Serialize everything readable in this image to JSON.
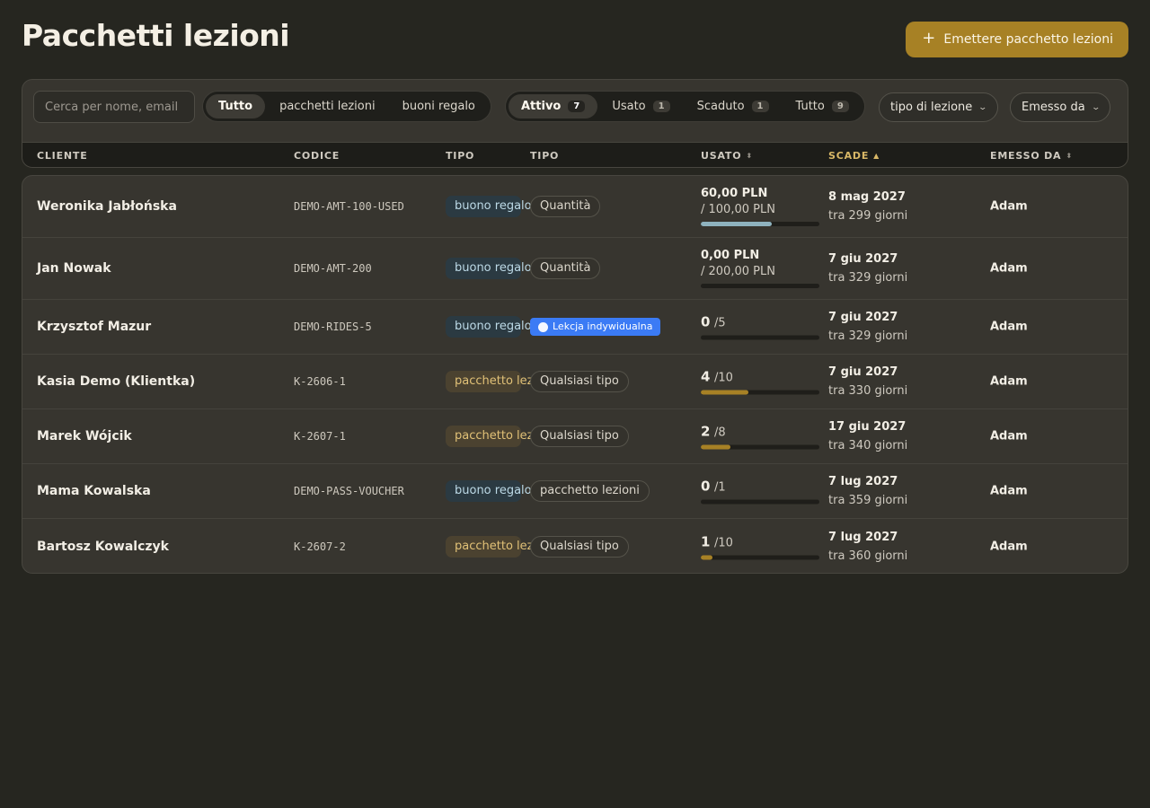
{
  "page": {
    "title": "Pacchetti lezioni",
    "issue_button": "Emettere pacchetto lezioni"
  },
  "search": {
    "placeholder": "Cerca per nome, email"
  },
  "kind_filter": [
    "Tutto",
    "pacchetti lezioni",
    "buoni regalo"
  ],
  "status_filter": [
    {
      "label": "Attivo",
      "count": "7"
    },
    {
      "label": "Usato",
      "count": "1"
    },
    {
      "label": "Scaduto",
      "count": "1"
    },
    {
      "label": "Tutto",
      "count": "9"
    }
  ],
  "dropdowns": {
    "lesson_type": "tipo di lezione",
    "issued_by": "Emesso da"
  },
  "columns": {
    "client": "CLIENTE",
    "code": "CODICE",
    "type": "TIPO",
    "type2": "TIPO",
    "used": "USATO",
    "expires": "SCADE",
    "issued_by": "EMESSO DA"
  },
  "colors": {
    "accent": "#a78125",
    "voucher_bar": "#8fb3bf",
    "pass_bar": "#a78125",
    "lesson_badge": "#3b7bf5"
  },
  "rows": [
    {
      "client": "Weronika Jabłońska",
      "code": "DEMO-AMT-100-USED",
      "type": "buono regalo",
      "kind": "Quantità",
      "used_main": "60,00 PLN",
      "used_sub": "/ 100,00 PLN",
      "progress": 0.6,
      "expires": "8 mag 2027",
      "expires_rel": "tra 299 giorni",
      "issuer": "Adam"
    },
    {
      "client": "Jan Nowak",
      "code": "DEMO-AMT-200",
      "type": "buono regalo",
      "kind": "Quantità",
      "used_main": "0,00 PLN",
      "used_sub": "/ 200,00 PLN",
      "progress": 0.0,
      "expires": "7 giu 2027",
      "expires_rel": "tra 329 giorni",
      "issuer": "Adam"
    },
    {
      "client": "Krzysztof Mazur",
      "code": "DEMO-RIDES-5",
      "type": "buono regalo",
      "kind": "Lekcja indywidualna",
      "used_num": "0",
      "used_den": "/5",
      "progress": 0.0,
      "expires": "7 giu 2027",
      "expires_rel": "tra 329 giorni",
      "issuer": "Adam"
    },
    {
      "client": "Kasia Demo (Klientka)",
      "code": "K-2606-1",
      "type": "pacchetto lezioni",
      "kind": "Qualsiasi tipo",
      "used_num": "4",
      "used_den": "/10",
      "progress": 0.4,
      "expires": "7 giu 2027",
      "expires_rel": "tra 330 giorni",
      "issuer": "Adam"
    },
    {
      "client": "Marek Wójcik",
      "code": "K-2607-1",
      "type": "pacchetto lezioni",
      "kind": "Qualsiasi tipo",
      "used_num": "2",
      "used_den": "/8",
      "progress": 0.25,
      "expires": "17 giu 2027",
      "expires_rel": "tra 340 giorni",
      "issuer": "Adam"
    },
    {
      "client": "Mama Kowalska",
      "code": "DEMO-PASS-VOUCHER",
      "type": "buono regalo",
      "kind": "pacchetto lezioni",
      "used_num": "0",
      "used_den": "/1",
      "progress": 0.0,
      "expires": "7 lug 2027",
      "expires_rel": "tra 359 giorni",
      "issuer": "Adam"
    },
    {
      "client": "Bartosz Kowalczyk",
      "code": "K-2607-2",
      "type": "pacchetto lezioni",
      "kind": "Qualsiasi tipo",
      "used_num": "1",
      "used_den": "/10",
      "progress": 0.1,
      "expires": "7 lug 2027",
      "expires_rel": "tra 360 giorni",
      "issuer": "Adam"
    }
  ]
}
